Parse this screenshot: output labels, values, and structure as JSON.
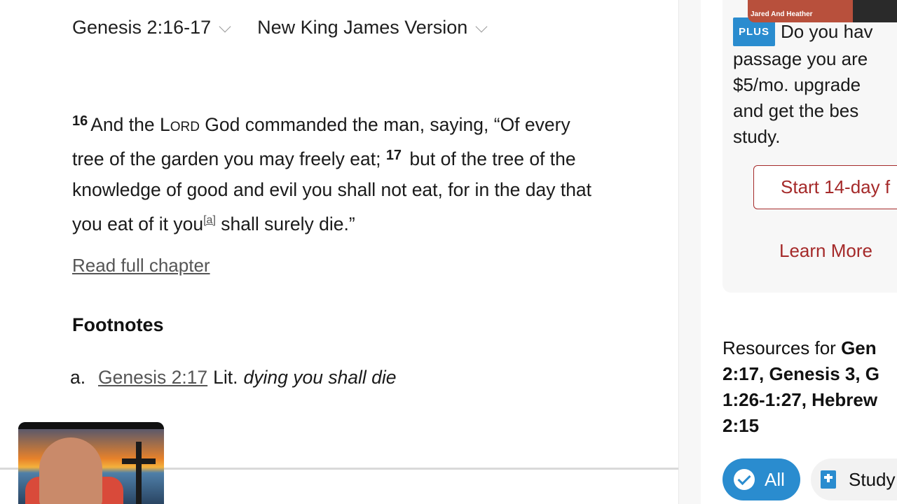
{
  "header": {
    "passage_ref": "Genesis 2:16-17",
    "version": "New King James Version"
  },
  "passage": {
    "verse16_num": "16",
    "verse16_a": "And the ",
    "verse16_lord": "Lord",
    "verse16_b": " God commanded the man, saying, “Of every tree of the garden you may freely eat; ",
    "verse17_num": "17",
    "verse17_a": " but of the tree of the knowledge of good and evil you shall not eat, for in the day that you eat of it you",
    "footnote_ref": "[a]",
    "verse17_b": " shall surely die.”"
  },
  "read_full_chapter": "Read full chapter",
  "footnotes": {
    "heading": "Footnotes",
    "items": [
      {
        "marker": "a.",
        "link": "Genesis 2:17",
        "prefix": "Lit.",
        "text": "dying you shall die"
      }
    ]
  },
  "sidebar": {
    "video_label": "Jared And Heather",
    "promo": {
      "badge": "PLUS",
      "line1": "Do you hav",
      "line2": "passage you are",
      "line3": "$5/mo. upgrade",
      "line4": "and get the bes",
      "line5": "study."
    },
    "trial_button": "Start 14-day f",
    "learn_more": "Learn More",
    "resources": {
      "prefix": "Resources for ",
      "line1_bold": "Gen",
      "line2_bold": "2:17, Genesis 3, G",
      "line3_bold": "1:26-1:27, Hebrew",
      "line4_bold": "2:15"
    },
    "filters": {
      "all": "All",
      "study": "Study"
    }
  },
  "colors": {
    "accent_blue": "#2a8ccf",
    "accent_red": "#a52a2a"
  }
}
